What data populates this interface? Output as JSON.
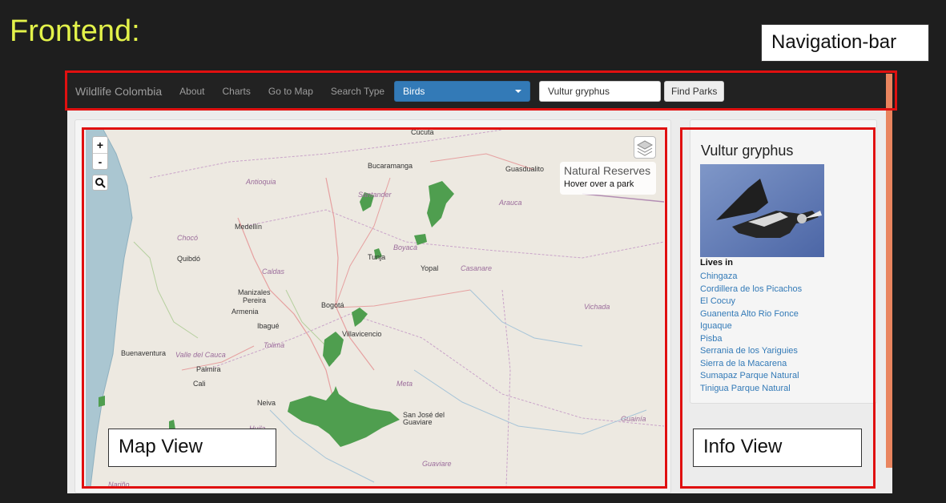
{
  "slide": {
    "title": "Frontend:"
  },
  "callouts": {
    "navigation": "Navigation-bar",
    "map": "Map View",
    "info": "Info View"
  },
  "navbar": {
    "brand": "Wildlife Colombia",
    "links": [
      "About",
      "Charts",
      "Go to Map"
    ],
    "search_type_label": "Search Type",
    "search_type_value": "Birds",
    "search_value": "Vultur gryphus",
    "find_button": "Find Parks"
  },
  "map": {
    "zoom_in": "+",
    "zoom_out": "-",
    "overlay_title": "Natural Reserves",
    "overlay_hint": "Hover over a park",
    "labels": {
      "cucuta": "Cúcuta",
      "bucaramanga": "Bucaramanga",
      "guasdualito": "Guasdualito",
      "antioquia": "Antioquia",
      "santander": "Santander",
      "arauca": "Arauca",
      "medellin": "Medellín",
      "choco": "Chocó",
      "quibdo": "Quibdó",
      "boyaca": "Boyacá",
      "tunja": "Tunja",
      "yopal": "Yopal",
      "casanare": "Casanare",
      "caldas": "Caldas",
      "manizales": "Manizales",
      "pereira": "Pereira",
      "armenia": "Armenia",
      "bogota": "Bogotá",
      "vichada": "Vichada",
      "ibague": "Ibagué",
      "villavicencio": "Villavicencio",
      "tolima": "Tolima",
      "buenaventura": "Buenaventura",
      "valle": "Valle del Cauca",
      "palmira": "Palmira",
      "cali": "Cali",
      "meta": "Meta",
      "neiva": "Neiva",
      "sanjose": "San José del Guaviare",
      "guainia": "Guainía",
      "guaviare": "Guaviare",
      "narino": "Nariño",
      "huila": "Huila"
    }
  },
  "info": {
    "species": "Vultur gryphus",
    "lives_in": "Lives in",
    "parks": [
      "Chingaza",
      "Cordillera de los Picachos",
      "El Cocuy",
      "Guanenta Alto Rio Fonce",
      "Iguaque",
      "Pisba",
      "Serrania de los Yariguies",
      "Sierra de la Macarena",
      "Sumapaz Parque Natural",
      "Tinigua Parque Natural"
    ]
  },
  "colors": {
    "title": "#e3f24a",
    "highlight": "#e01010",
    "select": "#337ab7",
    "park": "#4f9e4f"
  }
}
